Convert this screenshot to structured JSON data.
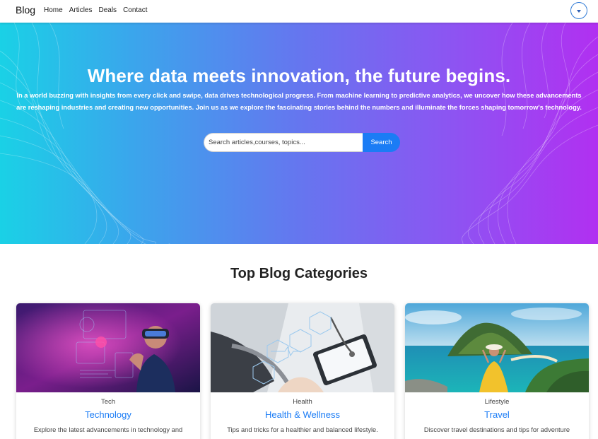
{
  "navbar": {
    "brand": "Blog",
    "links": [
      "Home",
      "Articles",
      "Deals",
      "Contact"
    ],
    "account_icon": "chevron-down-icon"
  },
  "hero": {
    "title": "Where data meets innovation, the future begins.",
    "description": "In a world buzzing with insights from every click and swipe, data drives technological progress. From machine learning to predictive analytics, we uncover how these advancements are reshaping industries and creating new opportunities. Join us as we explore the fascinating stories behind the numbers and illuminate the forces shaping tomorrow's technology.",
    "search": {
      "placeholder": "Search articles,courses, topics...",
      "value": "",
      "button_label": "Search"
    },
    "colors": {
      "gradient_start": "#1ad1e6",
      "gradient_mid": "#6576ef",
      "gradient_end": "#b130f1"
    }
  },
  "categories": {
    "heading": "Top Blog Categories",
    "cards": [
      {
        "category": "Tech",
        "title": "Technology",
        "description": "Explore the latest advancements in technology and",
        "image": "vr-headset-person"
      },
      {
        "category": "Health",
        "title": "Health & Wellness",
        "description": "Tips and tricks for a healthier and balanced lifestyle.",
        "image": "doctor-stethoscope-tablet"
      },
      {
        "category": "Lifestyle",
        "title": "Travel",
        "description": "Discover travel destinations and tips for adventure",
        "image": "island-beach-traveler"
      }
    ]
  },
  "accent_color": "#1b7cf5"
}
